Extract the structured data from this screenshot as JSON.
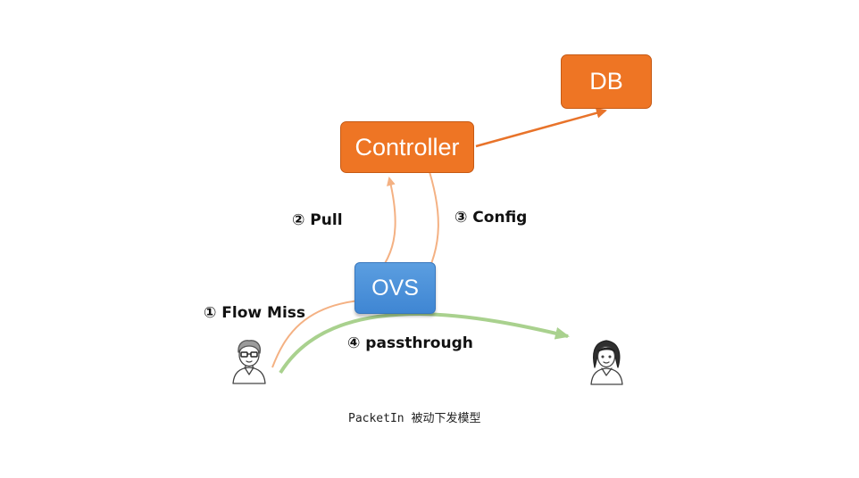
{
  "nodes": {
    "controller": "Controller",
    "db": "DB",
    "ovs": "OVS"
  },
  "steps": {
    "flow_miss": "① Flow Miss",
    "pull": "② Pull",
    "config": "③ Config",
    "passthrough": "④ passthrough"
  },
  "caption": "PacketIn 被动下发模型",
  "icons": {
    "sender": "man-with-glasses-icon",
    "receiver": "woman-icon"
  },
  "colors": {
    "node_orange": "#ee7524",
    "ovs_blue": "#4a90d9",
    "controller_to_db_arrow": "#e8732a",
    "control_arrows": "#f4b183",
    "passthrough_arrow": "#a9d18e"
  }
}
